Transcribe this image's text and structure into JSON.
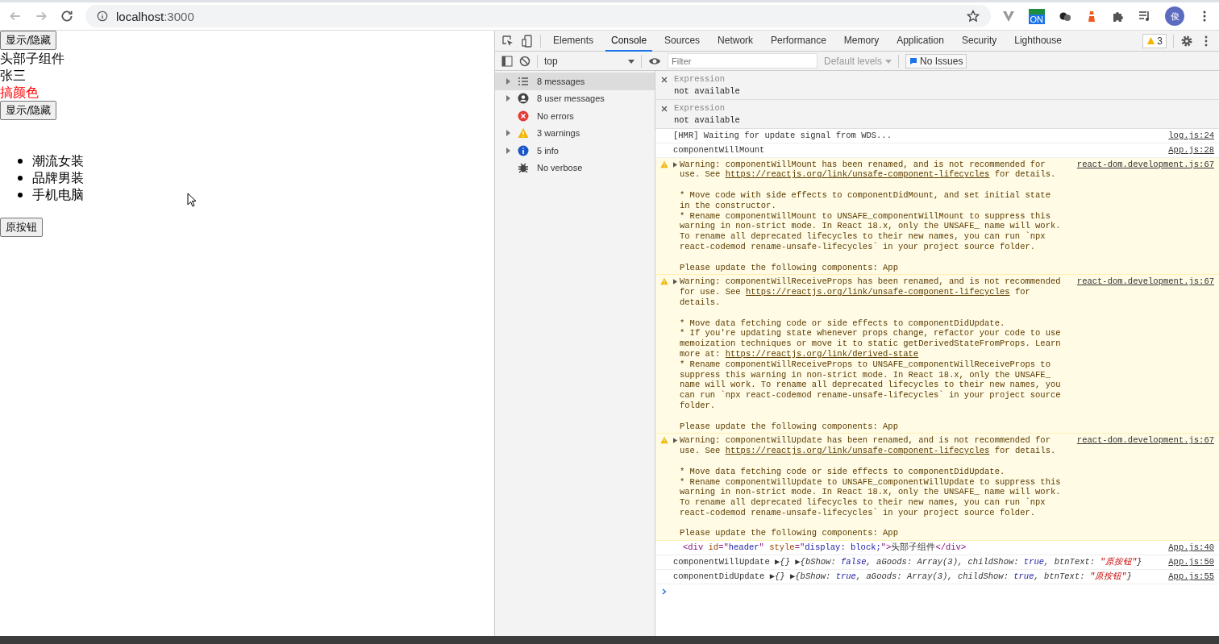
{
  "browser": {
    "url_host": "localhost",
    "url_port": ":3000",
    "extension_badge": "ON",
    "avatar": "俊"
  },
  "page": {
    "items": [
      {
        "kind": "button",
        "text": "显示/隐藏"
      },
      {
        "kind": "text",
        "text": "头部子组件",
        "color": "#000000"
      },
      {
        "kind": "text",
        "text": "张三",
        "color": "#000000"
      },
      {
        "kind": "text",
        "text": "搞颜色",
        "color": "#ff0000"
      },
      {
        "kind": "button",
        "text": "显示/隐藏"
      },
      {
        "kind": "list",
        "items": [
          "潮流女装",
          "品牌男装",
          "手机电脑"
        ]
      },
      {
        "kind": "button",
        "text": "原按钮"
      }
    ]
  },
  "devtools": {
    "tabs": [
      {
        "label": "Elements",
        "selected": false
      },
      {
        "label": "Console",
        "selected": true
      },
      {
        "label": "Sources",
        "selected": false
      },
      {
        "label": "Network",
        "selected": false
      },
      {
        "label": "Performance",
        "selected": false
      },
      {
        "label": "Memory",
        "selected": false
      },
      {
        "label": "Application",
        "selected": false
      },
      {
        "label": "Security",
        "selected": false
      },
      {
        "label": "Lighthouse",
        "selected": false
      }
    ],
    "issues_count": "3",
    "toolbar": {
      "context": "top",
      "filter_placeholder": "Filter",
      "levels": "Default levels",
      "issues": "No Issues"
    },
    "sidebar": [
      {
        "kind": "list",
        "label": "8 messages",
        "expandable": true,
        "selected": true
      },
      {
        "kind": "user",
        "label": "8 user messages",
        "expandable": true,
        "selected": false
      },
      {
        "kind": "error",
        "label": "No errors",
        "expandable": false,
        "selected": false
      },
      {
        "kind": "warning",
        "label": "3 warnings",
        "expandable": true,
        "selected": false
      },
      {
        "kind": "info",
        "label": "5 info",
        "expandable": true,
        "selected": false
      },
      {
        "kind": "verbose",
        "label": "No verbose",
        "expandable": false,
        "selected": false
      }
    ],
    "expressions": [
      {
        "label": "Expression",
        "value": "not available"
      },
      {
        "label": "Expression",
        "value": "not available"
      }
    ],
    "messages": [
      {
        "kind": "log",
        "segments": [
          {
            "kind": "plain",
            "text": "[HMR] Waiting for update signal from WDS..."
          }
        ],
        "source": "log.js:24"
      },
      {
        "kind": "log",
        "segments": [
          {
            "kind": "plain",
            "text": "componentWillMount"
          }
        ],
        "source": "App.js:28"
      },
      {
        "kind": "warning",
        "segments": [
          {
            "kind": "plain",
            "text": "Warning: componentWillMount has been renamed, and is not recommended for use. See "
          },
          {
            "kind": "link",
            "text": "https://reactjs.org/link/unsafe-component-lifecycles"
          },
          {
            "kind": "plain",
            "text": " for details.\n\n* Move code with side effects to componentDidMount, and set initial state in the constructor.\n* Rename componentWillMount to UNSAFE_componentWillMount to suppress this warning in non-strict mode. In React 18.x, only the UNSAFE_ name will work. To rename all deprecated lifecycles to their new names, you can run `npx react-codemod rename-unsafe-lifecycles` in your project source folder.\n\nPlease update the following components: App"
          }
        ],
        "source": "react-dom.development.js:67"
      },
      {
        "kind": "warning",
        "segments": [
          {
            "kind": "plain",
            "text": "Warning: componentWillReceiveProps has been renamed, and is not recommended for use. See "
          },
          {
            "kind": "link",
            "text": "https://reactjs.org/link/unsafe-component-lifecycles"
          },
          {
            "kind": "plain",
            "text": " for details.\n\n* Move data fetching code or side effects to componentDidUpdate.\n* If you're updating state whenever props change, refactor your code to use memoization techniques or move it to static getDerivedStateFromProps. Learn more at: "
          },
          {
            "kind": "link",
            "text": "https://reactjs.org/link/derived-state"
          },
          {
            "kind": "plain",
            "text": "\n* Rename componentWillReceiveProps to UNSAFE_componentWillReceiveProps to suppress this warning in non-strict mode. In React 18.x, only the UNSAFE_ name will work. To rename all deprecated lifecycles to their new names, you can run `npx react-codemod rename-unsafe-lifecycles` in your project source folder.\n\nPlease update the following components: App"
          }
        ],
        "source": "react-dom.development.js:67"
      },
      {
        "kind": "warning",
        "segments": [
          {
            "kind": "plain",
            "text": "Warning: componentWillUpdate has been renamed, and is not recommended for use. See "
          },
          {
            "kind": "link",
            "text": "https://reactjs.org/link/unsafe-component-lifecycles"
          },
          {
            "kind": "plain",
            "text": " for details.\n\n* Move data fetching code or side effects to componentDidUpdate.\n* Rename componentWillUpdate to UNSAFE_componentWillUpdate to suppress this warning in non-strict mode. In React 18.x, only the UNSAFE_ name will work. To rename all deprecated lifecycles to their new names, you can run `npx react-codemod rename-unsafe-lifecycles` in your project source folder.\n\nPlease update the following components: App"
          }
        ],
        "source": "react-dom.development.js:67"
      },
      {
        "kind": "element",
        "segments": [
          {
            "kind": "tag",
            "text": "<div "
          },
          {
            "kind": "attr",
            "text": "id"
          },
          {
            "kind": "tag",
            "text": "=\""
          },
          {
            "kind": "value",
            "text": "header"
          },
          {
            "kind": "tag",
            "text": "\" "
          },
          {
            "kind": "attr",
            "text": "style"
          },
          {
            "kind": "tag",
            "text": "=\""
          },
          {
            "kind": "value",
            "text": "display: block;"
          },
          {
            "kind": "tag",
            "text": "\">"
          },
          {
            "kind": "plain",
            "text": "头部子组件"
          },
          {
            "kind": "tag",
            "text": "</div>"
          }
        ],
        "source": "App.js:40"
      },
      {
        "kind": "log",
        "segments": [
          {
            "kind": "plain",
            "text": "componentWillUpdate "
          },
          {
            "kind": "italic",
            "text": "▶{} ▶{bShow: "
          },
          {
            "kind": "keyword",
            "text": "false"
          },
          {
            "kind": "italic",
            "text": ", aGoods: Array(3), childShow: "
          },
          {
            "kind": "keyword",
            "text": "true"
          },
          {
            "kind": "italic",
            "text": ", btnText: "
          },
          {
            "kind": "string",
            "text": "\"原按钮\""
          },
          {
            "kind": "italic",
            "text": "}"
          }
        ],
        "source": "App.js:50"
      },
      {
        "kind": "log",
        "segments": [
          {
            "kind": "plain",
            "text": "componentDidUpdate "
          },
          {
            "kind": "italic",
            "text": "▶{} ▶{bShow: "
          },
          {
            "kind": "keyword",
            "text": "true"
          },
          {
            "kind": "italic",
            "text": ", aGoods: Array(3), childShow: "
          },
          {
            "kind": "keyword",
            "text": "true"
          },
          {
            "kind": "italic",
            "text": ", btnText: "
          },
          {
            "kind": "string",
            "text": "\"原按钮\""
          },
          {
            "kind": "italic",
            "text": "}"
          }
        ],
        "source": "App.js:55"
      }
    ]
  }
}
